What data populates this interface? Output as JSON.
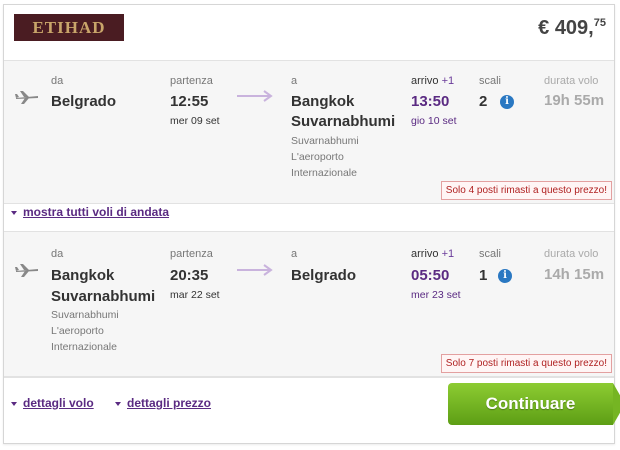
{
  "airline": {
    "logo_text": "ETIHAD",
    "name": "Etihad Airways"
  },
  "price": {
    "currency": "€",
    "integer": "409,",
    "decimals": "75"
  },
  "colors": {
    "accent": "#5a2a82",
    "button": "#6fb21c",
    "warning": "#b02222",
    "info": "#2a78c2"
  },
  "outbound": {
    "from_label": "da",
    "from_city": "Belgrado",
    "departure_label": "partenza",
    "departure_time": "12:55",
    "departure_date": "mer 09 set",
    "to_label": "a",
    "to_city_line1": "Bangkok",
    "to_city_line2": "Suvarnabhumi",
    "to_airport": [
      "Suvarnabhumi",
      "L'aeroporto",
      "Internazionale"
    ],
    "arrival_label": "arrivo",
    "arrival_plus": "+1",
    "arrival_time": "13:50",
    "arrival_date": "gio 10 set",
    "stops_label": "scali",
    "stops": "2",
    "duration_label": "durata volo",
    "duration": "19h 55m",
    "warning": "Solo 4 posti rimasti a questo prezzo!"
  },
  "show_all_link": "mostra tutti voli di andata",
  "inbound": {
    "from_label": "da",
    "from_city_line1": "Bangkok",
    "from_city_line2": "Suvarnabhumi",
    "from_airport": [
      "Suvarnabhumi",
      "L'aeroporto",
      "Internazionale"
    ],
    "departure_label": "partenza",
    "departure_time": "20:35",
    "departure_date": "mar 22 set",
    "to_label": "a",
    "to_city": "Belgrado",
    "arrival_label": "arrivo",
    "arrival_plus": "+1",
    "arrival_time": "05:50",
    "arrival_date": "mer 23 set",
    "stops_label": "scali",
    "stops": "1",
    "duration_label": "durata volo",
    "duration": "14h 15m",
    "warning": "Solo 7 posti rimasti a questo prezzo!"
  },
  "footer": {
    "flight_details": "dettagli volo",
    "price_details": "dettagli prezzo",
    "continue": "Continuare"
  },
  "icons": {
    "plane": "airplane-icon",
    "arrow": "right-arrow-icon",
    "info": "info-icon",
    "caret": "caret-down-icon"
  }
}
